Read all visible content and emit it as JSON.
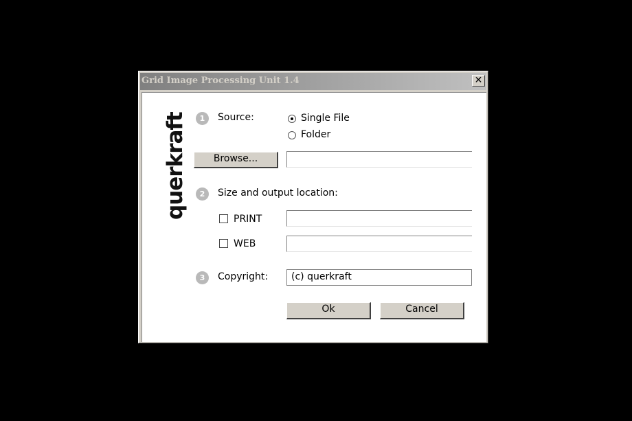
{
  "window": {
    "title": "Grid Image Processing Unit 1.4",
    "close_glyph": "✕"
  },
  "branding": {
    "logo_text": "querkraft"
  },
  "steps": [
    {
      "number": "1",
      "label": "Source:"
    },
    {
      "number": "2",
      "label": "Size and output location:"
    },
    {
      "number": "3",
      "label": "Copyright:"
    }
  ],
  "source": {
    "options": [
      {
        "label": "Single File",
        "selected": true
      },
      {
        "label": "Folder",
        "selected": false
      }
    ],
    "browse_label": "Browse...",
    "path_value": ""
  },
  "output": {
    "print": {
      "label": "PRINT",
      "checked": false,
      "path_value": ""
    },
    "web": {
      "label": "WEB",
      "checked": false,
      "path_value": ""
    }
  },
  "copyright": {
    "value": "(c) querkraft"
  },
  "buttons": {
    "ok": "Ok",
    "cancel": "Cancel"
  }
}
